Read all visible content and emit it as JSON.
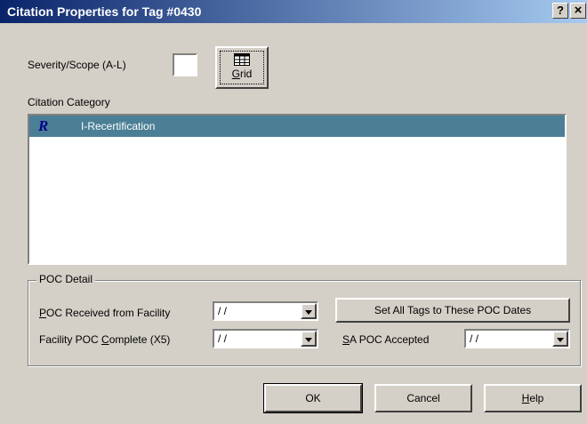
{
  "window": {
    "title": "Citation Properties for Tag #0430",
    "help_glyph": "?",
    "close_glyph": "×"
  },
  "severity": {
    "label_prefix": "Severity/Scope (A-L)",
    "value": ""
  },
  "grid_button": {
    "icon": "grid-icon",
    "label_underlined": "G",
    "label_rest": "rid"
  },
  "category": {
    "label": "Citation Category",
    "items": [
      {
        "icon": "recertification-icon",
        "icon_glyph": "R",
        "label": "I-Recertification",
        "selected": true
      }
    ],
    "selection_color": "#4b7f95"
  },
  "poc": {
    "group_title": "POC Detail",
    "received": {
      "label_underlined": "P",
      "label_rest": "OC Received from Facility",
      "value": " / /"
    },
    "complete": {
      "label_prefix": "Facility POC ",
      "label_underlined": "C",
      "label_rest": "omplete (X5)",
      "value": " / /"
    },
    "set_all_button": "Set All Tags to These POC Dates",
    "sa_accepted": {
      "label_underlined": "S",
      "label_rest": "A POC Accepted",
      "value": " / /"
    }
  },
  "buttons": {
    "ok": "OK",
    "cancel": "Cancel",
    "help_underlined": "H",
    "help_rest": "elp"
  },
  "colors": {
    "title_bar_start": "#0a246a",
    "title_bar_end": "#a6caf0",
    "face": "#d4d0c8"
  }
}
